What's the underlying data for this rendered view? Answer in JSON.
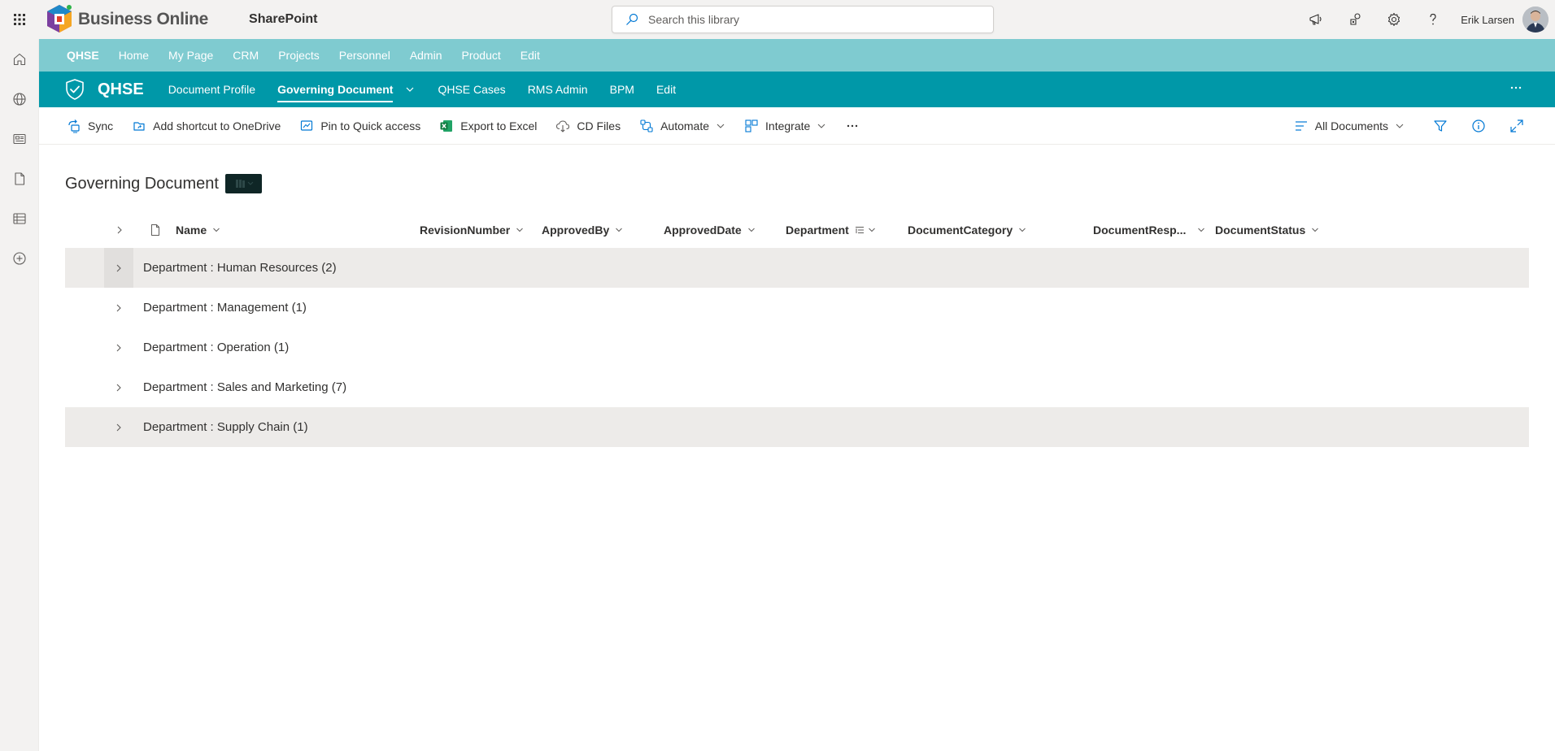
{
  "suite": {
    "brand_name": "Business Online",
    "app_name": "SharePoint",
    "search_placeholder": "Search this library",
    "user_name": "Erik Larsen",
    "icons": [
      "app-launcher-icon",
      "megaphone-icon",
      "people-connect-icon",
      "settings-icon",
      "help-icon"
    ]
  },
  "appbar": {
    "items": [
      "home-icon",
      "globe-icon",
      "news-icon",
      "document-icon",
      "list-icon",
      "add-circle-icon"
    ]
  },
  "hubnav": {
    "items": [
      "QHSE",
      "Home",
      "My Page",
      "CRM",
      "Projects",
      "Personnel",
      "Admin",
      "Product",
      "Edit"
    ]
  },
  "site": {
    "title": "QHSE",
    "nav": [
      "Document Profile",
      "Governing Document",
      "QHSE Cases",
      "RMS Admin",
      "BPM",
      "Edit"
    ],
    "active_nav": "Governing Document",
    "header_color": "#0098a8",
    "hub_color": "#7fcbd0"
  },
  "commandbar": {
    "sync": "Sync",
    "add_shortcut": "Add shortcut to OneDrive",
    "pin": "Pin to Quick access",
    "export": "Export to Excel",
    "cd_files": "CD Files",
    "automate": "Automate",
    "integrate": "Integrate",
    "more": "...",
    "view": "All Documents"
  },
  "library": {
    "title": "Governing Document",
    "columns": [
      "Name",
      "RevisionNumber",
      "ApprovedBy",
      "ApprovedDate",
      "Department",
      "DocumentCategory",
      "DocumentResp...",
      "DocumentStatus"
    ],
    "groups": [
      "Department : Human Resources (2)",
      "Department : Management (1)",
      "Department : Operation (1)",
      "Department : Sales and Marketing (7)",
      "Department : Supply Chain (1)"
    ]
  }
}
